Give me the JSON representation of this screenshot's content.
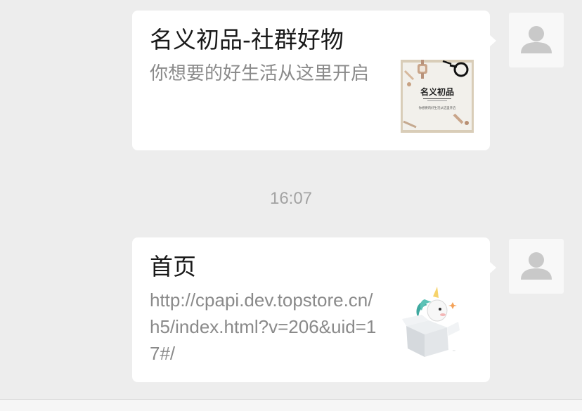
{
  "messages": [
    {
      "title": "名义初品-社群好物",
      "description": "你想要的好生活从这里开启",
      "thumbnail": {
        "icon": "brand-card-image",
        "brand_text": "名义初品",
        "tagline": "你想要的好生活从这里开启"
      },
      "avatar_icon": "user-placeholder-icon"
    },
    {
      "title": "首页",
      "description": "http://cpapi.dev.topstore.cn/h5/index.html?v=206&uid=17#/",
      "thumbnail": {
        "icon": "unicorn-box-image"
      },
      "avatar_icon": "user-placeholder-icon"
    }
  ],
  "timestamp": "16:07",
  "colors": {
    "background": "#ededed",
    "card": "#ffffff",
    "title": "#191919",
    "description": "#8a8a8a",
    "timestamp": "#a3a3a3",
    "avatar_bg": "#f8f8f8",
    "avatar_figure": "#c9c9c9"
  }
}
